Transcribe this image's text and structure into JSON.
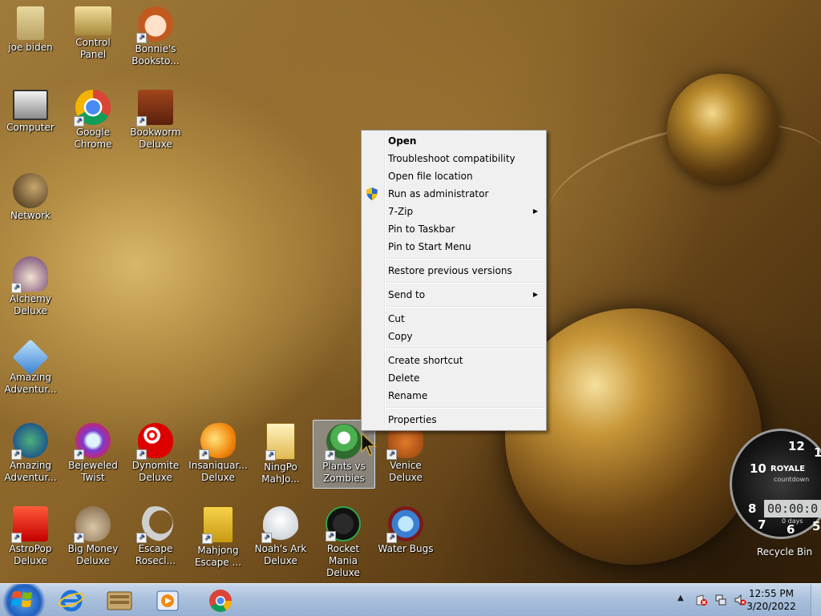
{
  "desktop_icons": [
    {
      "label": "joe biden",
      "icon": "user-folder-icon"
    },
    {
      "label": "Control Panel",
      "icon": "control-panel-icon"
    },
    {
      "label": "Bonnie's Booksto...",
      "icon": "bonnies-bookstore-icon"
    },
    {
      "label": "Computer",
      "icon": "computer-icon"
    },
    {
      "label": "Google Chrome",
      "icon": "chrome-icon"
    },
    {
      "label": "Bookworm Deluxe",
      "icon": "bookworm-icon"
    },
    {
      "label": "Network",
      "icon": "network-icon"
    },
    {
      "label": "Alchemy Deluxe",
      "icon": "alchemy-icon"
    },
    {
      "label": "Amazing Adventur...",
      "icon": "amazing-adventures-icon"
    },
    {
      "label": "Amazing Adventur...",
      "icon": "amazing-adventures-2-icon"
    },
    {
      "label": "Bejeweled Twist",
      "icon": "bejeweled-icon"
    },
    {
      "label": "Dynomite Deluxe",
      "icon": "dynomite-icon"
    },
    {
      "label": "Insaniquar... Deluxe",
      "icon": "insaniquarium-icon"
    },
    {
      "label": "NingPo MahJo...",
      "icon": "ningpo-icon"
    },
    {
      "label": "Plants vs Zombies",
      "icon": "plants-vs-zombies-icon"
    },
    {
      "label": "Venice Deluxe",
      "icon": "venice-icon"
    },
    {
      "label": "AstroPop Deluxe",
      "icon": "astropop-icon"
    },
    {
      "label": "Big Money Deluxe",
      "icon": "big-money-icon"
    },
    {
      "label": "Escape Rosecl...",
      "icon": "escape-rosecliff-icon"
    },
    {
      "label": "Mahjong Escape ...",
      "icon": "mahjong-escape-icon"
    },
    {
      "label": "Noah's Ark Deluxe",
      "icon": "noahs-ark-icon"
    },
    {
      "label": "Rocket Mania Deluxe",
      "icon": "rocket-mania-icon"
    },
    {
      "label": "Water Bugs",
      "icon": "water-bugs-icon"
    }
  ],
  "context_menu": {
    "items": [
      {
        "label": "Open",
        "bold": true
      },
      {
        "label": "Troubleshoot compatibility"
      },
      {
        "label": "Open file location"
      },
      {
        "label": "Run as administrator",
        "icon": "uac-shield-icon"
      },
      {
        "label": "7-Zip",
        "submenu": true
      },
      {
        "label": "Pin to Taskbar"
      },
      {
        "label": "Pin to Start Menu"
      },
      {
        "label": "Restore previous versions"
      },
      {
        "label": "Send to",
        "submenu": true
      },
      {
        "label": "Cut"
      },
      {
        "label": "Copy"
      },
      {
        "label": "Create shortcut"
      },
      {
        "label": "Delete"
      },
      {
        "label": "Rename"
      },
      {
        "label": "Properties"
      }
    ],
    "submenu_arrow": "▶"
  },
  "gadget": {
    "brand": "ROYALE",
    "subtitle": "countdown",
    "time": "00:00:0",
    "days": "0 days",
    "numerals": [
      "12",
      "1",
      "10",
      "8",
      "7",
      "6",
      "5"
    ]
  },
  "recycle_bin_label": "Recycle Bin",
  "taskbar": {
    "pinned": [
      "internet-explorer-icon",
      "library-icon",
      "media-player-icon",
      "chrome-icon"
    ],
    "tray_icons": [
      "action-center-icon",
      "network-tray-icon",
      "volume-muted-icon"
    ],
    "show_hidden": "▲",
    "time": "12:55 PM",
    "date": "3/20/2022"
  },
  "colors": {
    "selection": "#aac8f0",
    "taskbar": "#aac0dc",
    "menu_bg": "#f0f0f0"
  }
}
